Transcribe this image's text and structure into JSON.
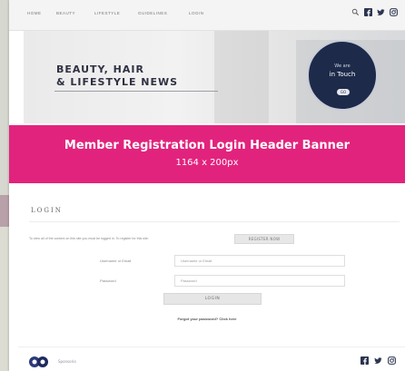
{
  "nav": {
    "items": [
      "HOME",
      "BEAUTY",
      "LIFESTYLE",
      "GUIDELINES",
      "LOGIN"
    ],
    "icons": [
      "search-icon",
      "facebook-icon",
      "twitter-icon",
      "instagram-icon"
    ]
  },
  "hero": {
    "title_line1": "BEAUTY, HAIR",
    "title_line2": "& LIFESTYLE NEWS",
    "badge_small": "We are",
    "badge_big": "in Touch",
    "badge_pill": "GO"
  },
  "banner": {
    "title": "Member Registration Login Header Banner",
    "subtitle": "1164 x 200px",
    "color": "#e2237d"
  },
  "login": {
    "heading": "LOGIN",
    "intro": "To view all of the content on this site you must be logged in. To register for this site:",
    "register_button": "REGISTER NOW",
    "username_label": "Username or Email",
    "username_placeholder": "Username or Email",
    "password_label": "Password",
    "password_placeholder": "Password",
    "login_button": "LOGIN",
    "forgot_link": "Forgot your password? Click here"
  },
  "footer": {
    "brand": "Sponsorio",
    "icons": [
      "facebook-icon",
      "twitter-icon",
      "instagram-icon"
    ]
  }
}
